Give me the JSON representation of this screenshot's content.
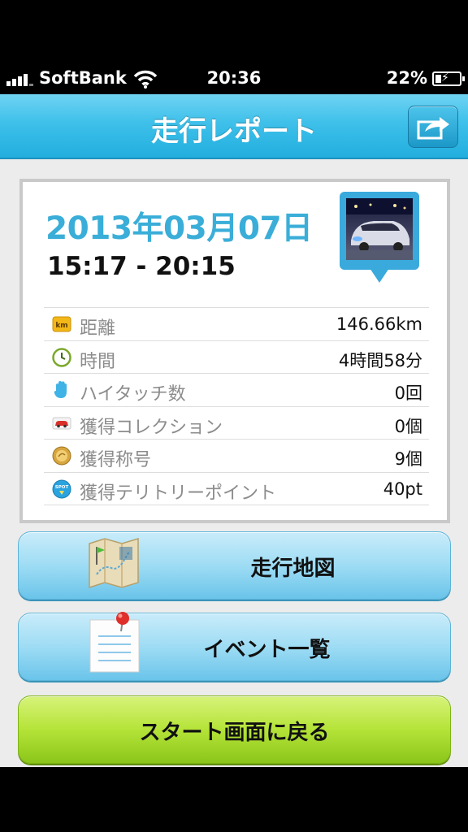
{
  "status_bar": {
    "carrier": "SoftBank",
    "time": "20:36",
    "battery": "22%"
  },
  "nav": {
    "title": "走行レポート",
    "share_icon": "share-arrow-icon"
  },
  "report": {
    "date": "2013年03月07日",
    "time_range": "15:17 - 20:15",
    "stats": [
      {
        "icon": "km-icon",
        "label": "距離",
        "value": "146.66km"
      },
      {
        "icon": "clock-icon",
        "label": "時間",
        "value": "4時間58分"
      },
      {
        "icon": "hand-icon",
        "label": "ハイタッチ数",
        "value": "0回"
      },
      {
        "icon": "car-icon",
        "label": "獲得コレクション",
        "value": "0個"
      },
      {
        "icon": "medal-icon",
        "label": "獲得称号",
        "value": "9個"
      },
      {
        "icon": "spot-icon",
        "label": "獲得テリトリーポイント",
        "value": "40pt"
      }
    ],
    "stat_icon_texts": {
      "km": "km",
      "spot": "SPOT"
    }
  },
  "buttons": {
    "map": "走行地図",
    "events": "イベント一覧",
    "back_to_start": "スタート画面に戻る"
  },
  "colors": {
    "nav_blue": "#3ec0ea",
    "date_blue": "#3aaed8",
    "button_blue": "#9edcf4",
    "button_green": "#b5e338"
  }
}
